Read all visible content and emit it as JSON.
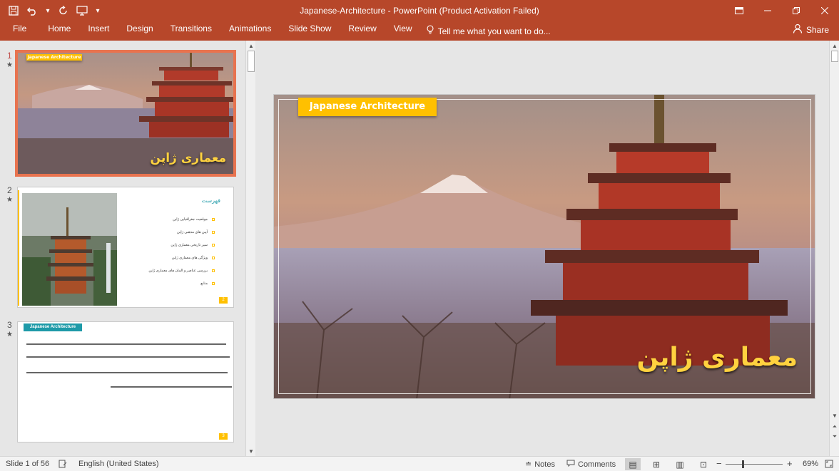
{
  "window": {
    "title": "Japanese-Architecture - PowerPoint (Product Activation Failed)"
  },
  "qat": {
    "save_icon": "save-icon",
    "undo_icon": "undo-icon",
    "redo_icon": "redo-icon",
    "present_icon": "present-from-beginning-icon",
    "customize_icon": "customize-qat-icon"
  },
  "ribbon": {
    "tabs": [
      "File",
      "Home",
      "Insert",
      "Design",
      "Transitions",
      "Animations",
      "Slide Show",
      "Review",
      "View"
    ],
    "tell_me": "Tell me what you want to do...",
    "share": "Share"
  },
  "thumbnails": {
    "numbers": [
      "1",
      "2",
      "3"
    ],
    "star": "★",
    "slide1": {
      "banner": "Japanese Architecture",
      "title": "معماری ژاپن"
    },
    "slide2": {
      "heading": "فهرست",
      "items": [
        "موقعیت جغرافیایی ژاپن",
        "آیین های مذهبی ژاپن",
        "سیر تاریخی معماری ژاپن",
        "ویژگی های معماری ژاپن",
        "بررسی عناصر و المان های معماری ژاپن",
        "منابع"
      ],
      "page_num": "2"
    },
    "slide3": {
      "banner": "Japanese Architecture",
      "page_num": "3"
    }
  },
  "main_slide": {
    "banner": "Japanese Architecture",
    "title": "معماری ژاپن"
  },
  "status": {
    "slide_indicator": "Slide 1 of 56",
    "language": "English (United States)",
    "notes": "Notes",
    "comments": "Comments",
    "zoom": "69%"
  },
  "colors": {
    "accent": "#b7472a",
    "banner": "#ffc000",
    "selection": "#e8734f",
    "teal": "#1e9aa8"
  }
}
